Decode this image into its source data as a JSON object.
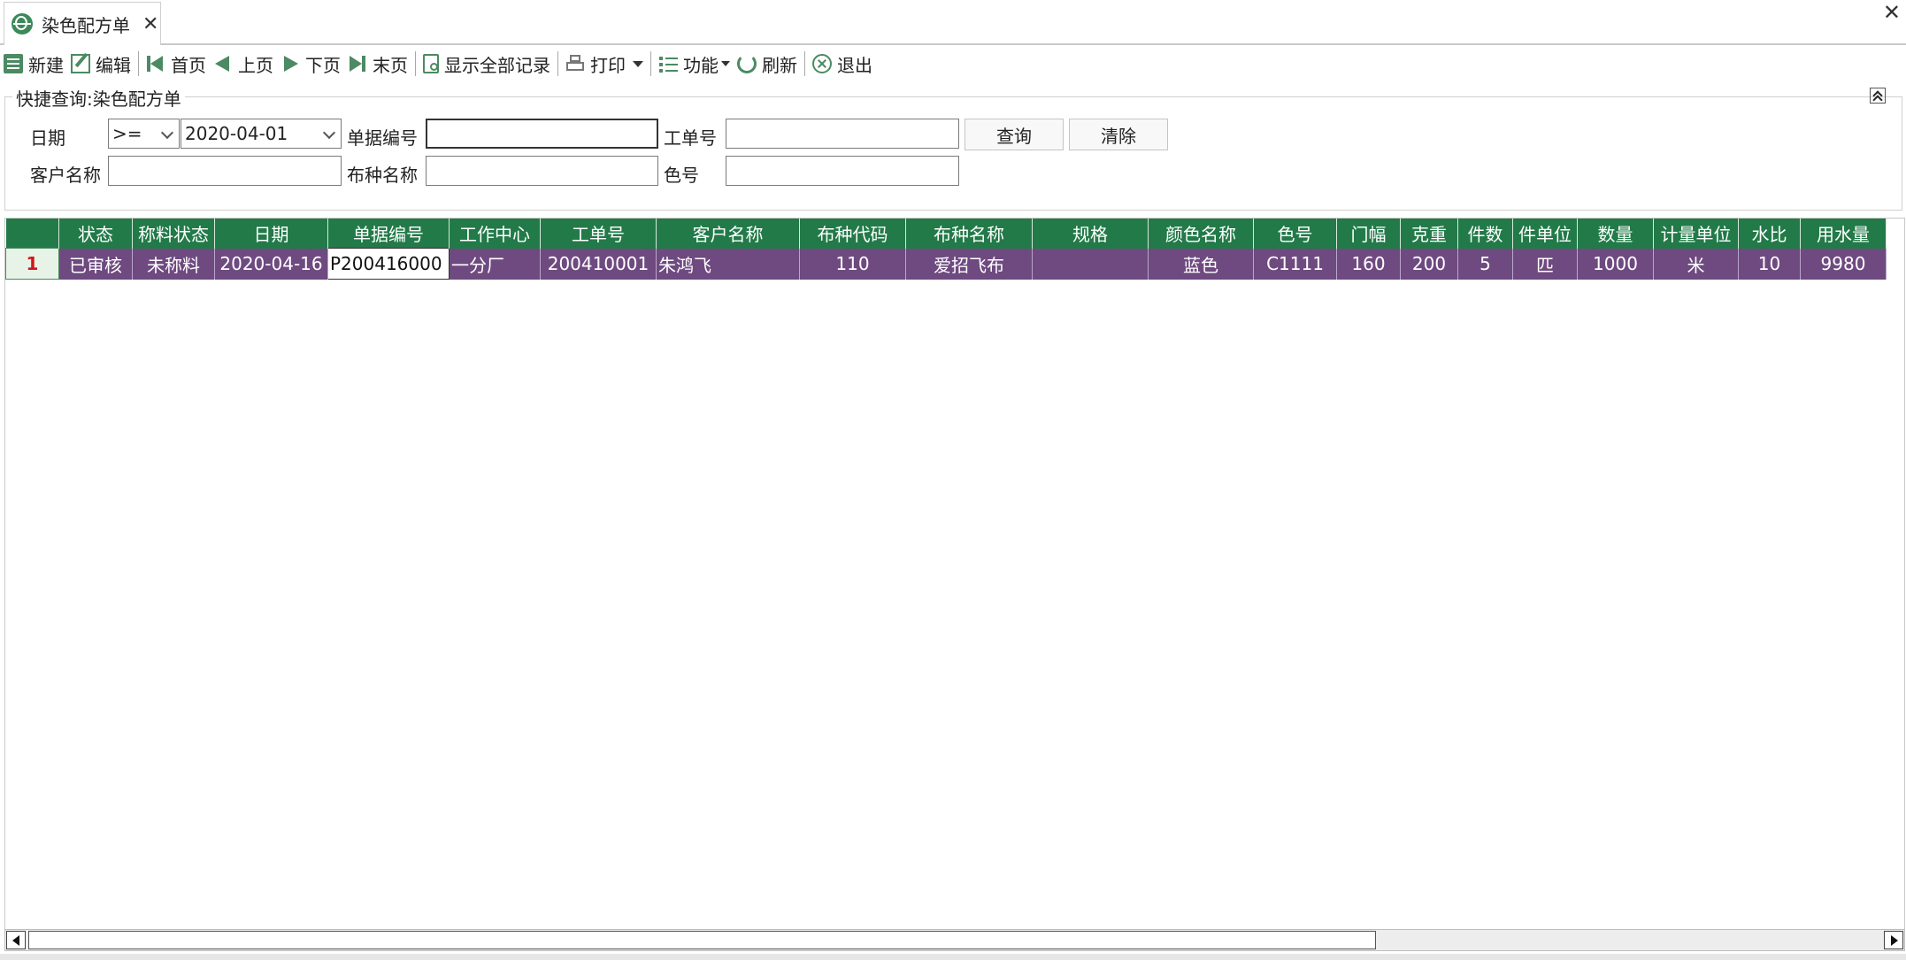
{
  "tab": {
    "title": "染色配方单",
    "close": "✕"
  },
  "window": {
    "close": "✕"
  },
  "toolbar": {
    "new": "新建",
    "edit": "编辑",
    "first": "首页",
    "prev": "上页",
    "next": "下页",
    "last": "末页",
    "show_all": "显示全部记录",
    "print": "打印",
    "function": "功能",
    "refresh": "刷新",
    "exit": "退出"
  },
  "query": {
    "title": "快捷查询:染色配方单",
    "date_label": "日期",
    "date_operator": ">=",
    "date_value": "2020-04-01",
    "doc_no_label": "单据编号",
    "doc_no_value": "",
    "work_order_label": "工单号",
    "work_order_value": "",
    "customer_label": "客户名称",
    "customer_value": "",
    "fabric_label": "布种名称",
    "fabric_value": "",
    "color_no_label": "色号",
    "color_no_value": "",
    "search_button": "查询",
    "clear_button": "清除"
  },
  "grid": {
    "columns": [
      "状态",
      "称料状态",
      "日期",
      "单据编号",
      "工作中心",
      "工单号",
      "客户名称",
      "布种代码",
      "布种名称",
      "规格",
      "颜色名称",
      "色号",
      "门幅",
      "克重",
      "件数",
      "件单位",
      "数量",
      "计量单位",
      "水比",
      "用水量"
    ],
    "rows": [
      {
        "rownum": "1",
        "cells": [
          "已审核",
          "未称料",
          "2020-04-16",
          "P200416000",
          "一分厂",
          "200410001",
          "朱鸿飞",
          "110",
          "爱招飞布",
          "",
          "蓝色",
          "C1111",
          "160",
          "200",
          "5",
          "匹",
          "1000",
          "米",
          "10",
          "9980"
        ]
      }
    ]
  }
}
